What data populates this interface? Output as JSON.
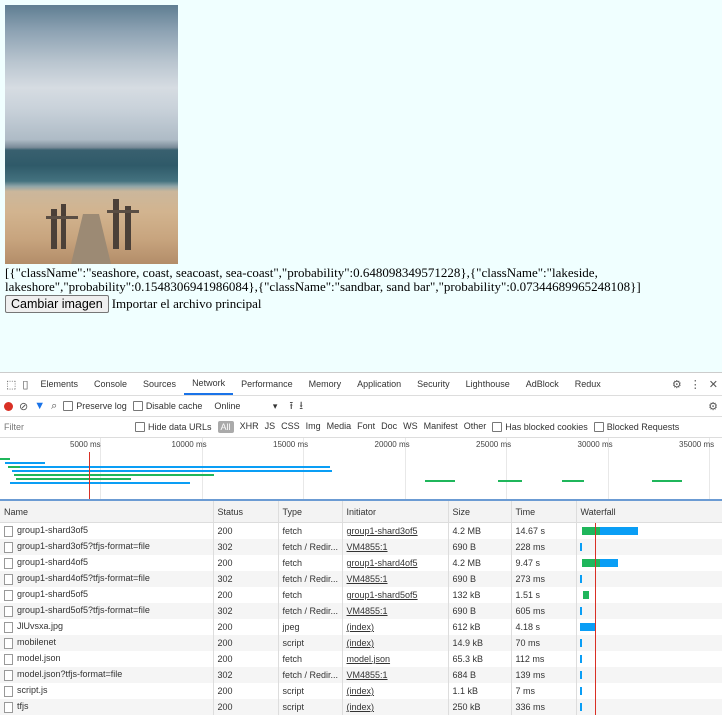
{
  "page": {
    "image_alt": "beach pier photo",
    "result_text": "[{\"className\":\"seashore, coast, seacoast, sea-coast\",\"probability\":0.648098349571228},{\"className\":\"lakeside, lakeshore\",\"probability\":0.1548306941986084},{\"className\":\"sandbar, sand bar\",\"probability\":0.07344689965248108}]",
    "button_label": "Cambiar imagen",
    "import_text": "Importar el archivo principal"
  },
  "devtools": {
    "tabs": [
      "Elements",
      "Console",
      "Sources",
      "Network",
      "Performance",
      "Memory",
      "Application",
      "Security",
      "Lighthouse",
      "AdBlock",
      "Redux"
    ],
    "active_tab": "Network",
    "toolbar": {
      "preserve_log": "Preserve log",
      "disable_cache": "Disable cache",
      "throttle": "Online"
    },
    "filter": {
      "placeholder": "Filter",
      "hide_data_urls": "Hide data URLs",
      "types": [
        "All",
        "XHR",
        "JS",
        "CSS",
        "Img",
        "Media",
        "Font",
        "Doc",
        "WS",
        "Manifest",
        "Other"
      ],
      "blocked_cookies": "Has blocked cookies",
      "blocked_requests": "Blocked Requests"
    },
    "overview_ticks": [
      "5000 ms",
      "10000 ms",
      "15000 ms",
      "20000 ms",
      "25000 ms",
      "30000 ms",
      "35000 ms"
    ],
    "columns": [
      "Name",
      "Status",
      "Type",
      "Initiator",
      "Size",
      "Time",
      "Waterfall"
    ],
    "rows": [
      {
        "name": "group1-shard3of5",
        "status": "200",
        "type": "fetch",
        "initiator": "group1-shard3of5",
        "size": "4.2 MB",
        "time": "14.67 s"
      },
      {
        "name": "group1-shard3of5?tfjs-format=file",
        "status": "302",
        "type": "fetch / Redir...",
        "initiator": "VM4855:1",
        "size": "690 B",
        "time": "228 ms"
      },
      {
        "name": "group1-shard4of5",
        "status": "200",
        "type": "fetch",
        "initiator": "group1-shard4of5",
        "size": "4.2 MB",
        "time": "9.47 s"
      },
      {
        "name": "group1-shard4of5?tfjs-format=file",
        "status": "302",
        "type": "fetch / Redir...",
        "initiator": "VM4855:1",
        "size": "690 B",
        "time": "273 ms"
      },
      {
        "name": "group1-shard5of5",
        "status": "200",
        "type": "fetch",
        "initiator": "group1-shard5of5",
        "size": "132 kB",
        "time": "1.51 s"
      },
      {
        "name": "group1-shard5of5?tfjs-format=file",
        "status": "302",
        "type": "fetch / Redir...",
        "initiator": "VM4855:1",
        "size": "690 B",
        "time": "605 ms"
      },
      {
        "name": "JlUvsxa.jpg",
        "status": "200",
        "type": "jpeg",
        "initiator": "(index)",
        "size": "612 kB",
        "time": "4.18 s"
      },
      {
        "name": "mobilenet",
        "status": "200",
        "type": "script",
        "initiator": "(index)",
        "size": "14.9 kB",
        "time": "70 ms"
      },
      {
        "name": "model.json",
        "status": "200",
        "type": "fetch",
        "initiator": "model.json",
        "size": "65.3 kB",
        "time": "112 ms"
      },
      {
        "name": "model.json?tfjs-format=file",
        "status": "302",
        "type": "fetch / Redir...",
        "initiator": "VM4855:1",
        "size": "684 B",
        "time": "139 ms"
      },
      {
        "name": "script.js",
        "status": "200",
        "type": "script",
        "initiator": "(index)",
        "size": "1.1 kB",
        "time": "7 ms"
      },
      {
        "name": "tfjs",
        "status": "200",
        "type": "script",
        "initiator": "(index)",
        "size": "250 kB",
        "time": "336 ms"
      }
    ],
    "colors": {
      "accent": "#1a73e8",
      "record": "#d93025",
      "wait": "#1fb65b",
      "download": "#0a9ef5"
    }
  }
}
